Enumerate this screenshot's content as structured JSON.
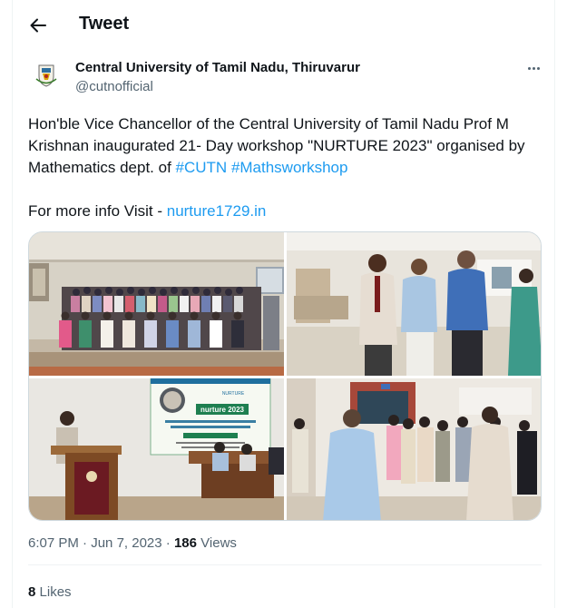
{
  "header": {
    "title": "Tweet",
    "back_icon": "arrow-left-icon"
  },
  "author": {
    "name": "Central University of Tamil Nadu, Thiruvarur",
    "handle": "@cutnofficial",
    "avatar_icon": "university-emblem-icon"
  },
  "tweet": {
    "line1": "Hon'ble Vice Chancellor of the Central University of Tamil Nadu Prof M",
    "line2": "Krishnan inaugurated 21- Day workshop \"NURTURE 2023\" organised by",
    "line3_text": "Mathematics dept. of ",
    "hashtag1": "#CUTN",
    "hashtag2": "#Mathsworkshop",
    "line5_text": "For more info Visit - ",
    "link": "nurture1729.in"
  },
  "media": {
    "banner_title": "nurture 2023",
    "banner_brand": "NURTURE",
    "banner_subtitle": "Summer School in Mathematics for the Students of Sciences Background",
    "banner_dates": "6th - 26th June 2023"
  },
  "meta": {
    "time": "6:07 PM",
    "date": "Jun 7, 2023",
    "views_count": "186",
    "views_label": "Views",
    "sep": "·"
  },
  "likes": {
    "count": "8",
    "label": "Likes"
  },
  "colors": {
    "accent": "#1d9bf0",
    "text": "#0f1419",
    "muted": "#536471",
    "border": "#cfd9de"
  }
}
